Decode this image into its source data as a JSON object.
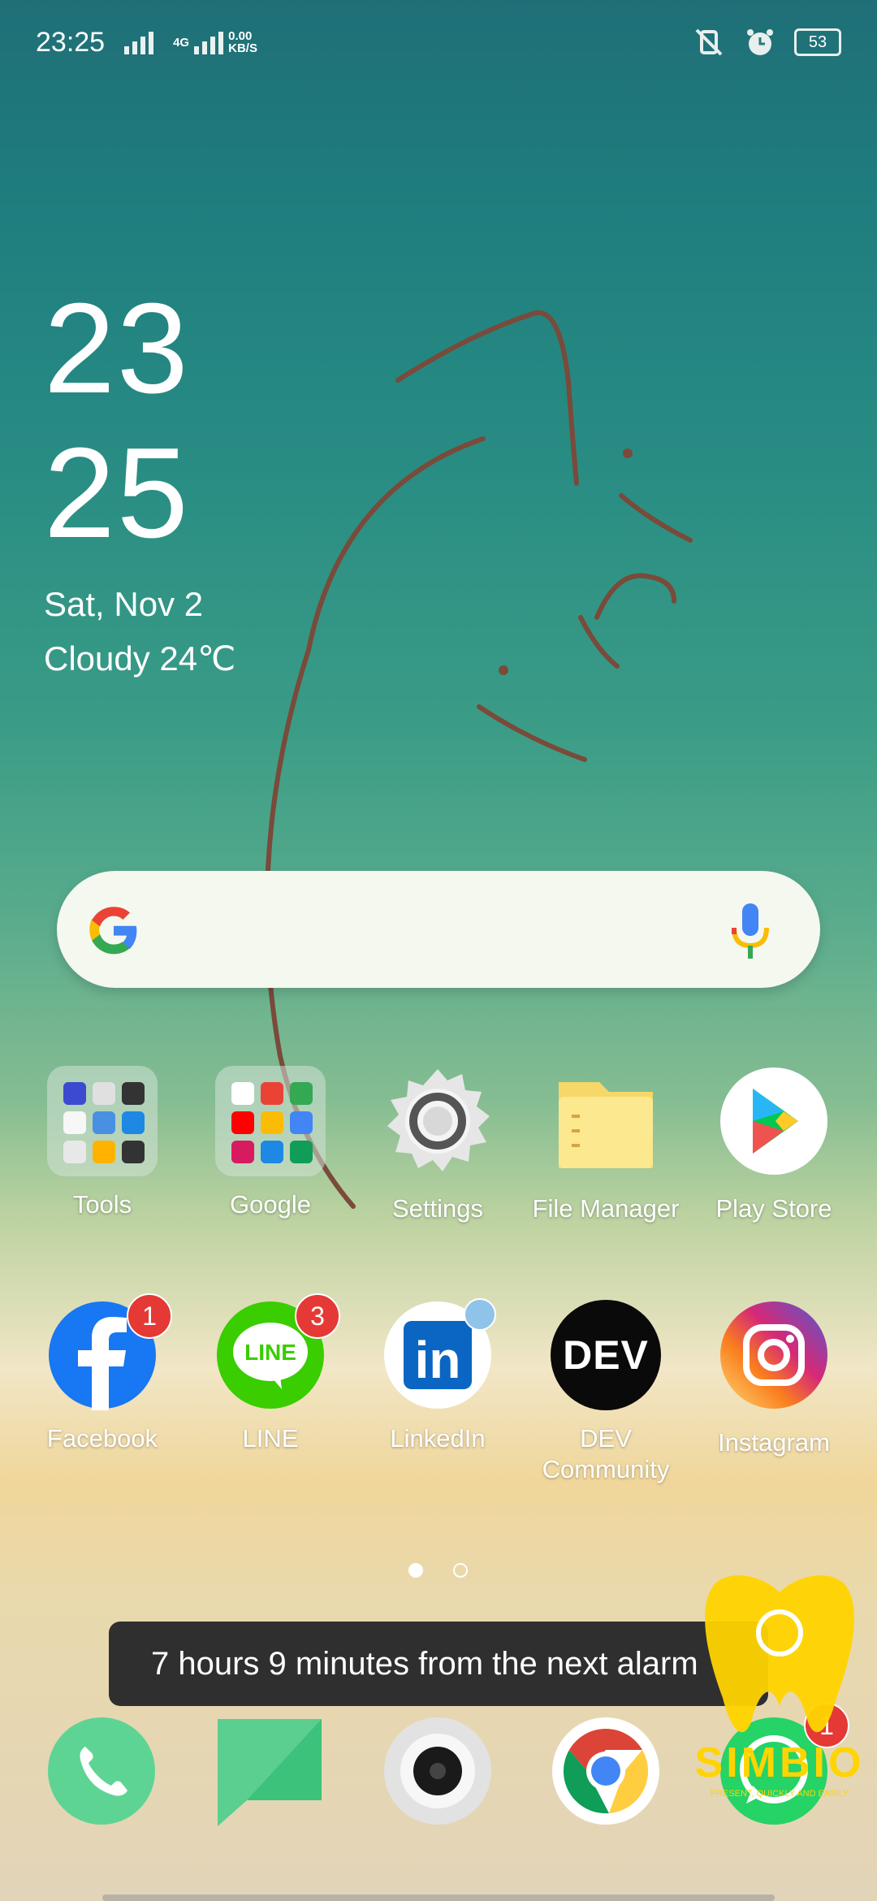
{
  "status_bar": {
    "time": "23:25",
    "net_type": "4G",
    "speed_value": "0.00",
    "speed_unit": "KB/S",
    "battery": "53"
  },
  "clock_widget": {
    "hour": "23",
    "minute": "25",
    "date": "Sat, Nov 2",
    "weather": "Cloudy 24℃"
  },
  "apps_row1": [
    {
      "label": "Tools"
    },
    {
      "label": "Google"
    },
    {
      "label": "Settings"
    },
    {
      "label": "File Manager"
    },
    {
      "label": "Play Store"
    }
  ],
  "apps_row2": [
    {
      "label": "Facebook",
      "badge": "1"
    },
    {
      "label": "LINE",
      "badge": "3"
    },
    {
      "label": "LinkedIn"
    },
    {
      "label": "DEV Community",
      "icon_text": "DEV"
    },
    {
      "label": "Instagram"
    }
  ],
  "line_icon_text": "LINE",
  "linkedin_icon_text": "in",
  "toast": "7 hours 9 minutes from the next alarm",
  "dock": [
    "phone-icon",
    "messages-icon",
    "camera-icon",
    "chrome-icon",
    "whatsapp-icon"
  ],
  "whatsapp_badge": "1",
  "watermark": {
    "text": "SIMBIO",
    "sub": "PRESENT, QUICKLY AND EASILY"
  },
  "colors": {
    "accent_red": "#e53935",
    "facebook": "#1877f2",
    "line": "#3acd00"
  }
}
